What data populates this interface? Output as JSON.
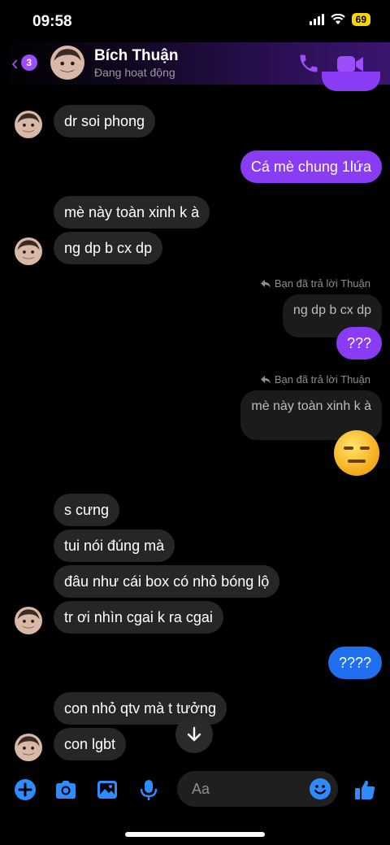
{
  "status_bar": {
    "time": "09:58",
    "battery": "69"
  },
  "header": {
    "unread_count": "3",
    "contact_name": "Bích Thuận",
    "contact_status": "Đang hoạt động"
  },
  "messages": {
    "m1": "dr soi phong",
    "m2": "Cá mè chung 1lứa",
    "m3": "mè này toàn xinh k à",
    "m4": "ng dp b cx dp",
    "reply_label_1": "Bạn đã trả lời Thuận",
    "quote_1": "ng dp b cx dp",
    "m5": "???",
    "reply_label_2": "Bạn đã trả lời Thuận",
    "quote_2": "mè này toàn xinh k à",
    "m6": "s cưng",
    "m7": "tui nói đúng mà",
    "m8": "đâu như cái box có nhỏ bóng lộ",
    "m9": "tr ơi nhìn cgai k ra cgai",
    "m10": "????",
    "m11": "con nhỏ qtv mà t tưởng",
    "m12": "con lgbt"
  },
  "composer": {
    "placeholder": "Aa"
  },
  "colors": {
    "accent": "#9d4dfa",
    "outgoing_purple": "#8a3cf5",
    "outgoing_blue": "#1f6ff0",
    "incoming": "#262626",
    "composer_icons": "#2d8cff"
  },
  "icons": [
    "chevron-left-icon",
    "phone-icon",
    "video-camera-icon",
    "reply-arrow-icon",
    "expressionless-face-emoji",
    "arrow-down-icon",
    "plus-icon",
    "camera-icon",
    "image-icon",
    "microphone-icon",
    "smile-icon",
    "thumbs-up-icon"
  ]
}
